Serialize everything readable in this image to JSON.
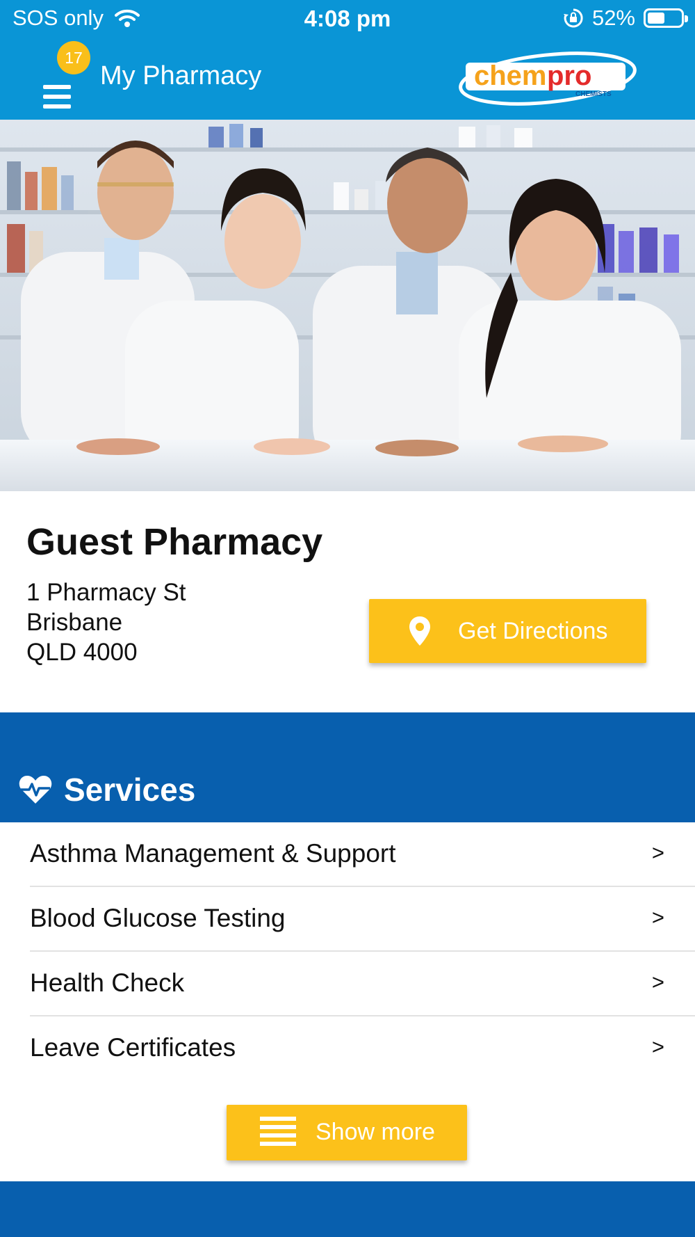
{
  "status_bar": {
    "carrier": "SOS only",
    "time": "4:08 pm",
    "battery_percent_text": "52%",
    "battery_level": 0.52,
    "icons": [
      "wifi-icon",
      "rotation-lock-icon",
      "battery-icon"
    ]
  },
  "app_bar": {
    "menu_icon": "hamburger-menu-icon",
    "notification_count": "17",
    "title": "My Pharmacy",
    "brand": {
      "wordmark_part1": "chem",
      "wordmark_part2": "pro",
      "subtext": "CHEMISTS"
    }
  },
  "hero": {
    "description_icon": "pharmacy-staff-photo"
  },
  "pharmacy": {
    "name": "Guest Pharmacy",
    "address_line1": "1 Pharmacy St",
    "address_line2": "Brisbane",
    "address_line3": "QLD 4000",
    "directions_label": "Get Directions",
    "directions_icon": "map-pin-icon"
  },
  "services": {
    "title": "Services",
    "icon": "heart-pulse-icon",
    "items": [
      {
        "label": "Asthma Management & Support",
        "chevron": ">"
      },
      {
        "label": "Blood Glucose Testing",
        "chevron": ">"
      },
      {
        "label": "Health Check",
        "chevron": ">"
      },
      {
        "label": "Leave Certificates",
        "chevron": ">"
      }
    ],
    "show_more_label": "Show more",
    "show_more_icon": "list-icon"
  },
  "colors": {
    "app_bar": "#0a95d6",
    "accent_yellow": "#fcc11a",
    "services_band": "#085fae",
    "brand_orange": "#f5a21b",
    "brand_red": "#e42b2b"
  }
}
